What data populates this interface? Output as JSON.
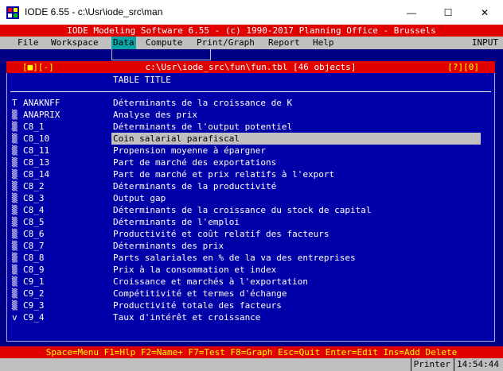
{
  "window": {
    "title": "IODE 6.55 - c:\\Usr\\iode_src\\man",
    "minimize_glyph": "—",
    "maximize_glyph": "☐",
    "close_glyph": "✕"
  },
  "app": {
    "header": "IODE Modeling Software 6.55 - (c) 1990-2017 Planning Office - Brussels"
  },
  "menu": {
    "items": [
      {
        "label": "File"
      },
      {
        "label": "Workspace"
      },
      {
        "label": "Data"
      },
      {
        "label": "Compute"
      },
      {
        "label": "Print/Graph"
      },
      {
        "label": "Report"
      },
      {
        "label": "Help"
      }
    ],
    "active": "Data",
    "input_mode": "INPUT"
  },
  "table_window": {
    "left_controls": "[■][-]",
    "path": "c:\\Usr\\iode_src\\fun\\fun.tbl [46 objects]",
    "right_controls": "[?][0]",
    "column_header": "TABLE TITLE",
    "rows": [
      {
        "scroll": "T",
        "name": "ANAKNFF",
        "title": "Déterminants de la croissance de K"
      },
      {
        "scroll": "▒",
        "name": "ANAPRIX",
        "title": "Analyse des prix"
      },
      {
        "scroll": "▒",
        "name": "C8_1",
        "title": "Déterminants de l'output potentiel"
      },
      {
        "scroll": "▒",
        "name": "C8_10",
        "title": "Coin salarial parafiscal"
      },
      {
        "scroll": "▒",
        "name": "C8_11",
        "title": "Propension moyenne à épargner"
      },
      {
        "scroll": "▒",
        "name": "C8_13",
        "title": "Part de marché des exportations"
      },
      {
        "scroll": "▒",
        "name": "C8_14",
        "title": "Part de marché et prix relatifs à l'export"
      },
      {
        "scroll": "▒",
        "name": "C8_2",
        "title": "Déterminants de la productivité"
      },
      {
        "scroll": "▒",
        "name": "C8_3",
        "title": "Output gap"
      },
      {
        "scroll": "▒",
        "name": "C8_4",
        "title": "Déterminants de la croissance du stock de capital"
      },
      {
        "scroll": "▒",
        "name": "C8_5",
        "title": "Déterminants de l'emploi"
      },
      {
        "scroll": "▒",
        "name": "C8_6",
        "title": "Productivité et coût relatif des facteurs"
      },
      {
        "scroll": "▒",
        "name": "C8_7",
        "title": "Déterminants des prix"
      },
      {
        "scroll": "▒",
        "name": "C8_8",
        "title": "Parts salariales en % de la va des entreprises"
      },
      {
        "scroll": "▒",
        "name": "C8_9",
        "title": "Prix à la consommation et index"
      },
      {
        "scroll": "▒",
        "name": "C9_1",
        "title": "Croissance et marchés à l'exportation"
      },
      {
        "scroll": "▒",
        "name": "C9_2",
        "title": "Compétitivité et termes d'échange"
      },
      {
        "scroll": "▒",
        "name": "C9_3",
        "title": "Productivité totale des facteurs"
      },
      {
        "scroll": "v",
        "name": "C9_4",
        "title": "Taux d'intérêt et croissance"
      }
    ],
    "selected_row": "C8_10"
  },
  "status": {
    "keys": "Space=Menu F1=Hlp F2=Name+ F7=Test F8=Graph Esc=Quit Enter=Edit Ins=Add Delete"
  },
  "bottom": {
    "printer": "Printer",
    "time": "14:54:44"
  },
  "colors": {
    "console_bg": "#000084",
    "window_bg": "#0000a8",
    "header_red": "#e00000",
    "menu_grey": "#c0c0c0",
    "active_menu": "#0aa6a6",
    "status_text": "#ffff00"
  }
}
